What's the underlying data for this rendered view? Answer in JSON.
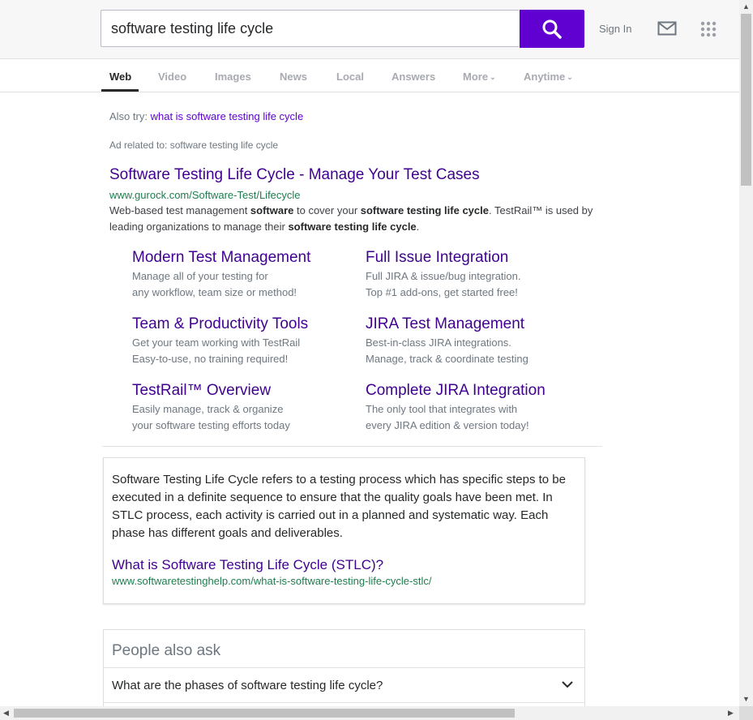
{
  "search": {
    "query": "software testing life cycle",
    "signin": "Sign In"
  },
  "tabs": [
    {
      "label": "Web"
    },
    {
      "label": "Video"
    },
    {
      "label": "Images"
    },
    {
      "label": "News"
    },
    {
      "label": "Local"
    },
    {
      "label": "Answers"
    },
    {
      "label": "More"
    },
    {
      "label": "Anytime"
    }
  ],
  "also_try": {
    "prefix": "Also try:",
    "link": "what is software testing life cycle"
  },
  "ad": {
    "label": "Ad related to: software testing life cycle",
    "title": "Software Testing Life Cycle - Manage Your Test Cases",
    "url": "www.gurock.com/Software-Test/Lifecycle",
    "desc": [
      {
        "text": "Web-based test management ",
        "bold": false
      },
      {
        "text": "software",
        "bold": true
      },
      {
        "text": " to cover your ",
        "bold": false
      },
      {
        "text": "software testing life cycle",
        "bold": true
      },
      {
        "text": ". TestRail™ is used by leading organizations to manage their ",
        "bold": false
      },
      {
        "text": "software testing life cycle",
        "bold": true
      },
      {
        "text": ".",
        "bold": false
      }
    ],
    "sitelinks": [
      {
        "title": "Modern Test Management",
        "line1": "Manage all of your testing for",
        "line2": "any workflow, team size or method!"
      },
      {
        "title": "Full Issue Integration",
        "line1": "Full JIRA & issue/bug integration.",
        "line2": "Top #1 add-ons, get started free!"
      },
      {
        "title": "Team & Productivity Tools",
        "line1": "Get your team working with TestRail",
        "line2": "Easy-to-use, no training required!"
      },
      {
        "title": "JIRA Test Management",
        "line1": "Best-in-class JIRA integrations.",
        "line2": "Manage, track & coordinate testing"
      },
      {
        "title": "TestRail™ Overview",
        "line1": "Easily manage, track & organize",
        "line2": "your software testing efforts today"
      },
      {
        "title": "Complete JIRA Integration",
        "line1": "The only tool that integrates with",
        "line2": "every JIRA edition & version today!"
      }
    ]
  },
  "answer_card": {
    "text": "Software Testing Life Cycle refers to a testing process which has specific steps to be executed in a definite sequence to ensure that the quality goals have been met. In STLC process, each activity is carried out in a planned and systematic way. Each phase has different goals and deliverables.",
    "link": "What is Software Testing Life Cycle (STLC)?",
    "url": "www.softwaretestinghelp.com/what-is-software-testing-life-cycle-stlc/"
  },
  "people_also_ask": {
    "title": "People also ask",
    "questions": [
      "What are the phases of software testing life cycle?"
    ]
  },
  "colors": {
    "accent": "#6001d2",
    "link": "#400090",
    "url_green": "#1e7d4e"
  }
}
